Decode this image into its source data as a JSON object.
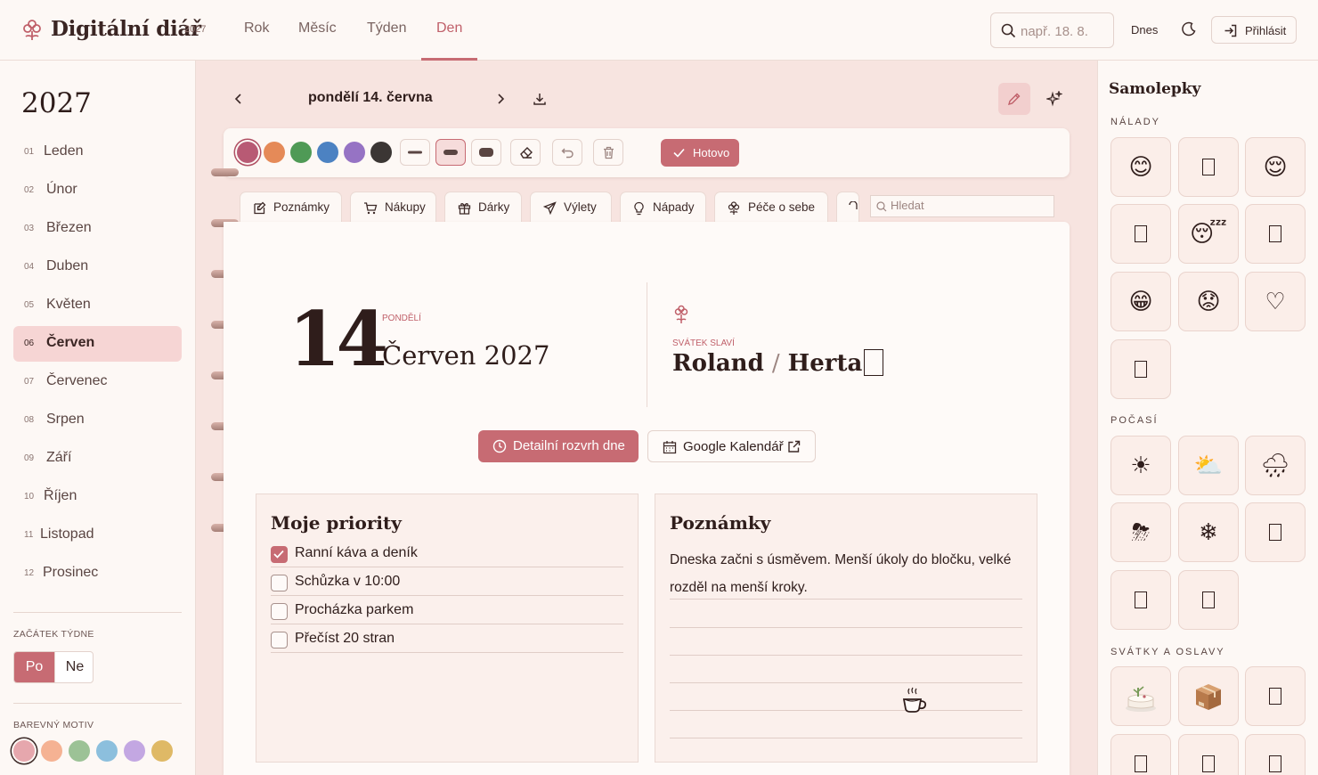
{
  "app": {
    "title": "Digitální diář",
    "year": "2027"
  },
  "nav": {
    "items": [
      "Rok",
      "Měsíc",
      "Týden",
      "Den"
    ],
    "active": "Den"
  },
  "header": {
    "search_placeholder": "např. 18. 8.",
    "today_label": "Dnes",
    "login_label": "Přihlásit"
  },
  "sidebar": {
    "year": "2027",
    "months": [
      {
        "num": "01",
        "name": "Leden"
      },
      {
        "num": "02",
        "name": "Únor"
      },
      {
        "num": "03",
        "name": "Březen"
      },
      {
        "num": "04",
        "name": "Duben"
      },
      {
        "num": "05",
        "name": "Květen"
      },
      {
        "num": "06",
        "name": "Červen"
      },
      {
        "num": "07",
        "name": "Červenec"
      },
      {
        "num": "08",
        "name": "Srpen"
      },
      {
        "num": "09",
        "name": "Září"
      },
      {
        "num": "10",
        "name": "Říjen"
      },
      {
        "num": "11",
        "name": "Listopad"
      },
      {
        "num": "12",
        "name": "Prosinec"
      }
    ],
    "active_month": "Červen",
    "week_start_label": "ZAČÁTEK TÝDNE",
    "week_options": [
      "Po",
      "Ne"
    ],
    "week_selected": "Po",
    "theme_label": "BAREVNÝ MOTIV",
    "theme_colors": [
      "#e6a7ad",
      "#f5b293",
      "#9cc296",
      "#8cbfdd",
      "#c3a7e2",
      "#dfb966"
    ]
  },
  "day_header": {
    "date_title": "pondělí 14. června"
  },
  "toolbar": {
    "pen_colors": [
      "#b85a74",
      "#e58a58",
      "#4f9a56",
      "#4c82c2",
      "#9673c4",
      "#3b3634"
    ],
    "done_label": "Hotovo"
  },
  "tabs": [
    {
      "label": "Poznámky",
      "icon": "notes-icon"
    },
    {
      "label": "Nákupy",
      "icon": "cart-icon"
    },
    {
      "label": "Dárky",
      "icon": "gift-icon"
    },
    {
      "label": "Výlety",
      "icon": "plane-icon"
    },
    {
      "label": "Nápady",
      "icon": "bulb-icon"
    },
    {
      "label": "Péče o sebe",
      "icon": "flower-icon"
    }
  ],
  "tab_search_placeholder": "Hledat",
  "day": {
    "number": "14",
    "weekday_label": "PONDĚLÍ",
    "month_year": "Červen 2027",
    "svatek_label": "SVÁTEK SLAVÍ",
    "svatek_name_1": "Roland",
    "svatek_sep": "/",
    "svatek_name_2": "Herta"
  },
  "actions": {
    "schedule_label": "Detailní rozvrh dne",
    "google_label": "Google Kalendář"
  },
  "priorities": {
    "title": "Moje priority",
    "items": [
      {
        "text": "Ranní káva a deník",
        "checked": true
      },
      {
        "text": "Schůzka v 10:00",
        "checked": false
      },
      {
        "text": "Procházka parkem",
        "checked": false
      },
      {
        "text": "Přečíst 20 stran",
        "checked": false
      }
    ]
  },
  "notes": {
    "title": "Poznámky",
    "text": "Dneska začni s úsměvem. Menší úkoly do bločku, velké rozděl na menší kroky."
  },
  "stickers": {
    "title": "Samolepky",
    "sections": [
      {
        "label": "NÁLADY",
        "items": [
          "😊",
          "□",
          "😌",
          "□",
          "😴",
          "□",
          "😁",
          "😟",
          "♡",
          "□"
        ]
      },
      {
        "label": "POČASÍ",
        "items": [
          "☀",
          "⛅",
          "🌧",
          "⛈",
          "❄",
          "□",
          "□",
          "□"
        ]
      },
      {
        "label": "SVÁTKY A OSLAVY",
        "items": [
          "🎂",
          "📦",
          "□",
          "□",
          "□",
          "□"
        ]
      }
    ]
  }
}
